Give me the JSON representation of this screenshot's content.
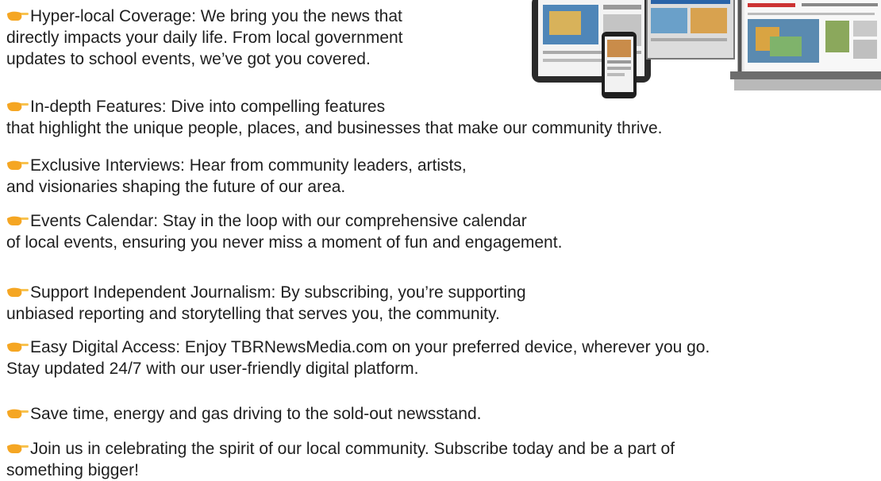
{
  "promo_image": {
    "alt": "Devices showing TBRNewsMedia.com pages"
  },
  "icons": {
    "bullet": "pointing-hand-icon"
  },
  "colors": {
    "text": "#1f1f1f",
    "hand": "#f5a623"
  },
  "items": [
    {
      "name": "hyper-local",
      "lines": [
        "Hyper-local Coverage: We bring you the news that",
        "directly impacts your daily life. From local government",
        "updates to school events, we’ve got you covered."
      ]
    },
    {
      "name": "in-depth",
      "lines": [
        "In-depth Features: Dive into compelling features",
        "that highlight the unique people, places, and businesses that make our community thrive."
      ]
    },
    {
      "name": "exclusive-interviews",
      "lines": [
        "Exclusive Interviews: Hear from community leaders, artists,",
        "and visionaries shaping the future of our area."
      ]
    },
    {
      "name": "events-calendar",
      "lines": [
        "Events Calendar: Stay in the loop with our comprehensive calendar",
        "of local events, ensuring you never miss a moment of fun and engagement."
      ]
    },
    {
      "name": "support-journalism",
      "lines": [
        "Support Independent Journalism: By subscribing, you’re supporting",
        "unbiased reporting and storytelling that serves you, the community."
      ]
    },
    {
      "name": "digital-access",
      "lines": [
        "Easy Digital Access: Enjoy TBRNewsMedia.com on your preferred device, wherever you go.",
        "Stay updated 24/7 with our user-friendly digital platform."
      ]
    },
    {
      "name": "save-time",
      "lines": [
        "Save time, energy and gas driving to the sold-out newsstand."
      ]
    },
    {
      "name": "join-us",
      "lines": [
        "Join us in celebrating the spirit of our local community. Subscribe today and be a part of",
        "something bigger!"
      ]
    }
  ]
}
